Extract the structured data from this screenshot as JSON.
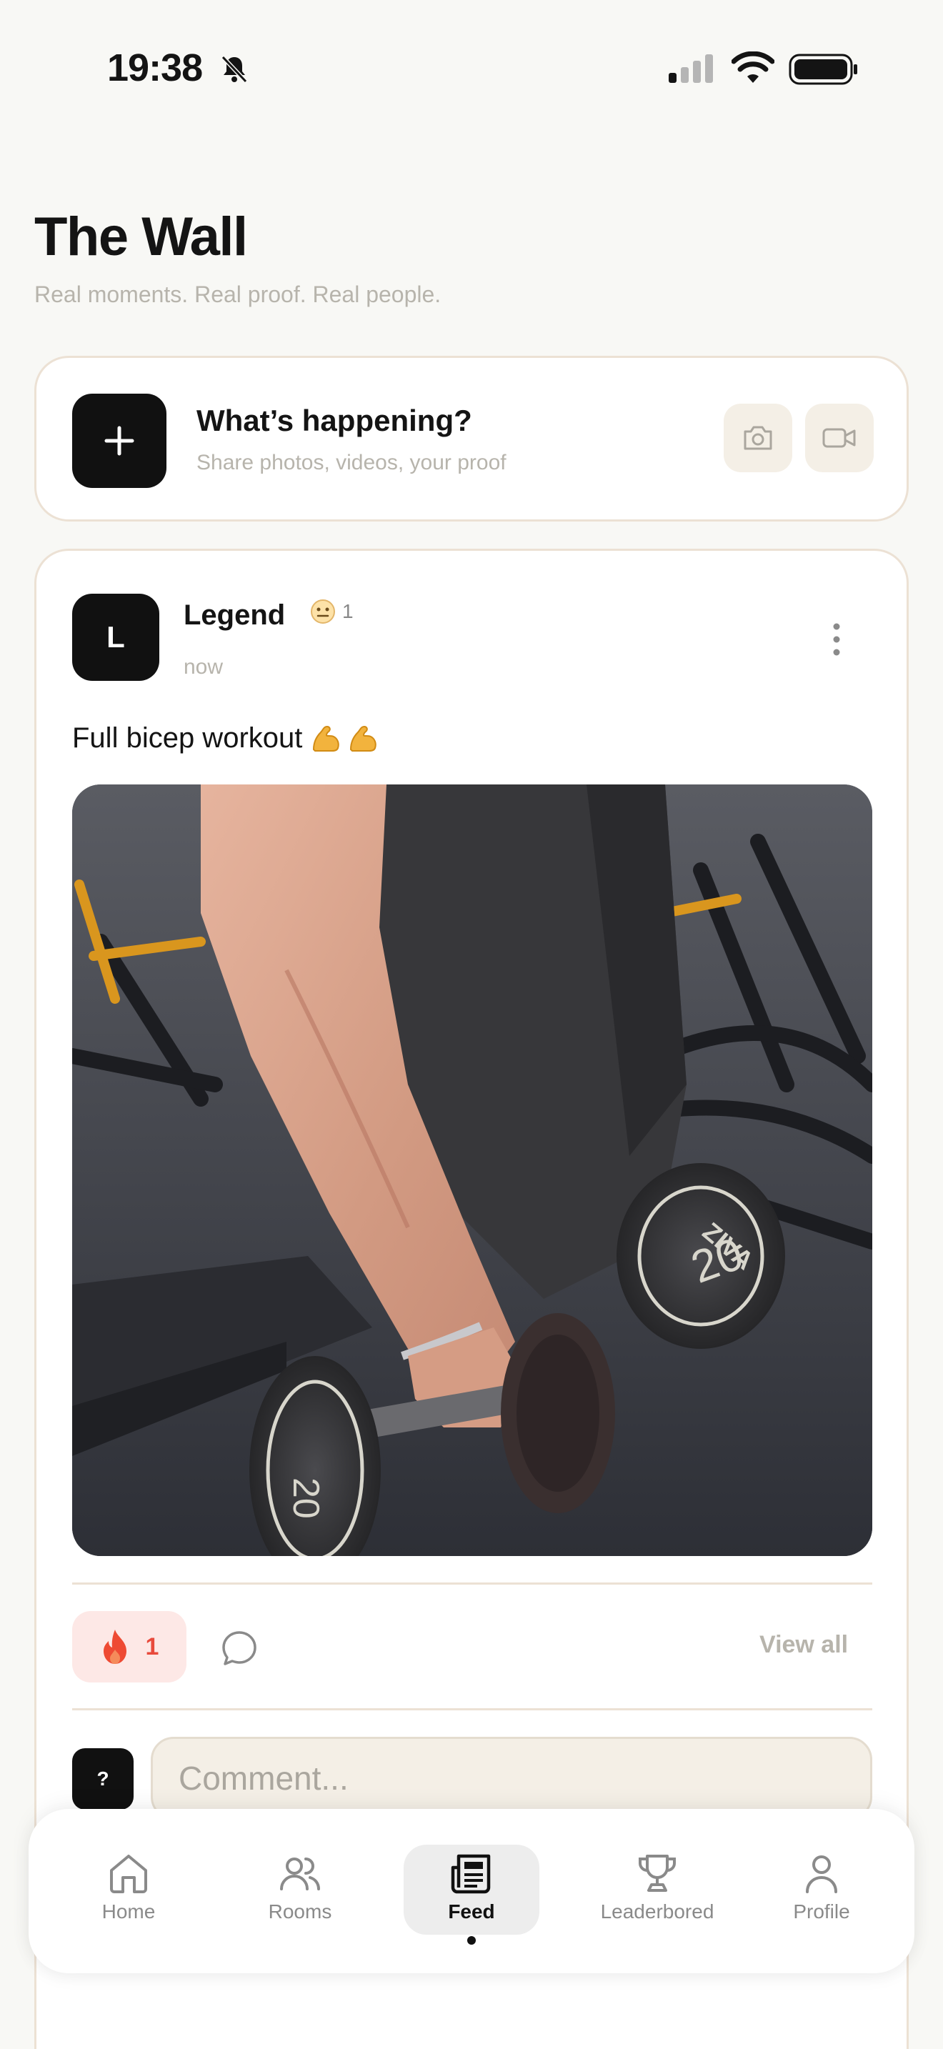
{
  "status_bar": {
    "time": "19:38",
    "icons": [
      "bell-slash-icon",
      "cellular-signal-icon",
      "wifi-icon",
      "battery-icon"
    ]
  },
  "header": {
    "title": "The Wall",
    "subtitle": "Real moments. Real proof. Real people."
  },
  "composer": {
    "title": "What’s happening?",
    "subtitle": "Share photos, videos, your proof",
    "add_icon": "plus-icon",
    "camera_icon": "camera-icon",
    "video_icon": "video-icon"
  },
  "post": {
    "avatar_initial": "L",
    "username": "Legend",
    "rank_icon": "neutral-face-icon",
    "rank_count": "1",
    "time": "now",
    "caption": "Full bicep workout",
    "caption_emoji": [
      "flexed-biceps-icon",
      "flexed-biceps-icon"
    ],
    "image": "gym-dumbbell-photo",
    "reaction_icon": "fire-icon",
    "reaction_count": "1",
    "view_all_label": "View all",
    "comment_avatar": "?",
    "comment_placeholder": "Comment..."
  },
  "tab_bar": {
    "items": [
      {
        "label": "Home",
        "icon": "home-icon",
        "active": false
      },
      {
        "label": "Rooms",
        "icon": "people-icon",
        "active": false
      },
      {
        "label": "Feed",
        "icon": "newspaper-icon",
        "active": true
      },
      {
        "label": "Leaderbored",
        "icon": "trophy-icon",
        "active": false
      },
      {
        "label": "Profile",
        "icon": "person-icon",
        "active": false
      }
    ]
  },
  "colors": {
    "background": "#f8f8f5",
    "card_border": "#ece1d4",
    "accent_dark": "#111111",
    "reaction_bg": "#fde8e6",
    "reaction_text": "#e84a3c",
    "muted_text": "#b7b4ac"
  }
}
